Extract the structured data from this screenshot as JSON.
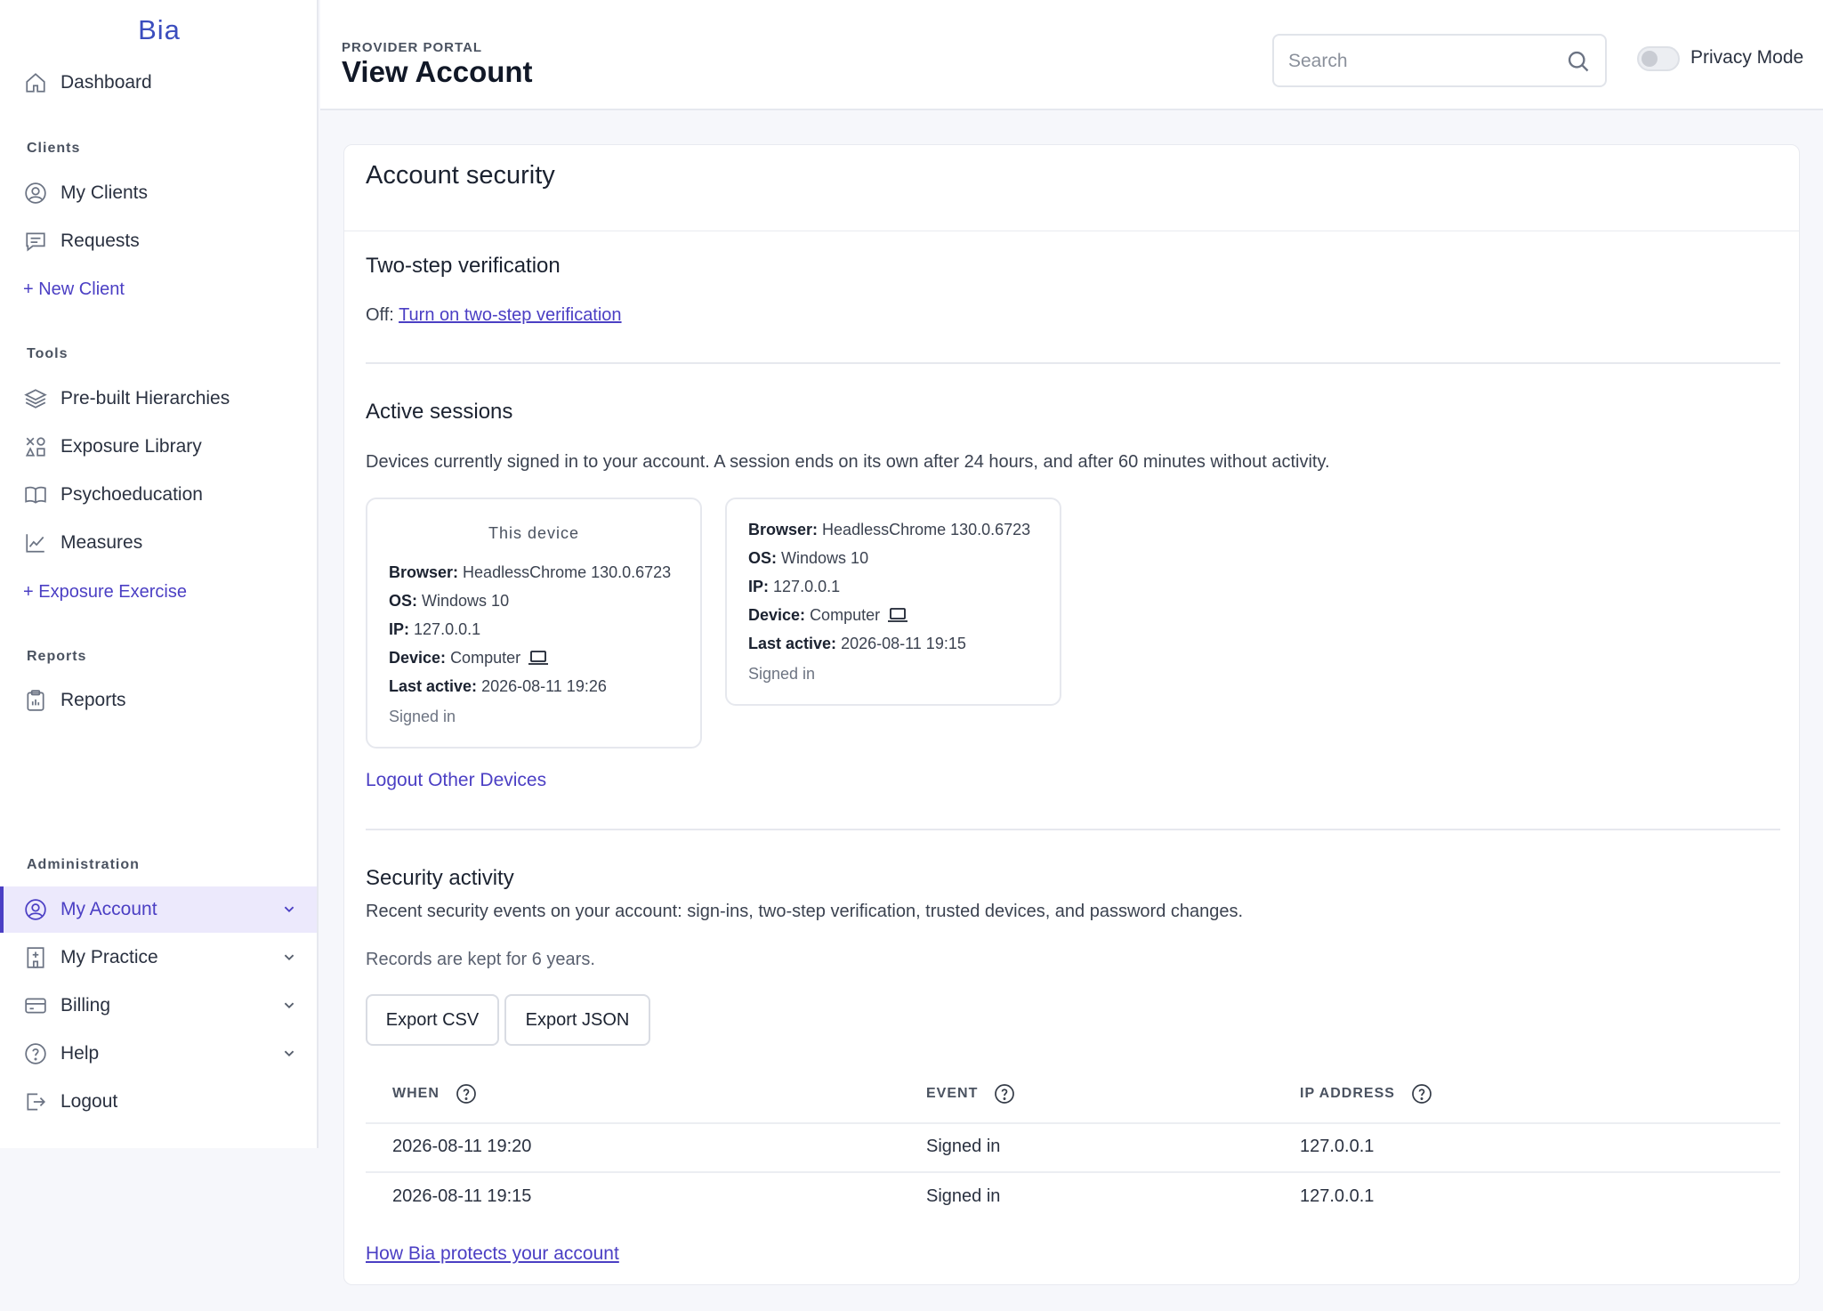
{
  "brand": "Bia",
  "header": {
    "portal_label": "PROVIDER PORTAL",
    "title": "View Account",
    "search_placeholder": "Search",
    "privacy_mode_label": "Privacy Mode",
    "privacy_mode_on": false
  },
  "sidebar": {
    "dashboard": "Dashboard",
    "clients_section": "Clients",
    "my_clients": "My Clients",
    "requests": "Requests",
    "new_client": "+ New Client",
    "tools_section": "Tools",
    "prebuilt": "Pre-built Hierarchies",
    "exposure_library": "Exposure Library",
    "psychoeducation": "Psychoeducation",
    "measures": "Measures",
    "exposure_exercise": "+ Exposure Exercise",
    "reports_section": "Reports",
    "reports": "Reports",
    "admin_section": "Administration",
    "my_account": "My Account",
    "my_practice": "My Practice",
    "billing": "Billing",
    "help": "Help",
    "logout": "Logout",
    "accent_color": "#4b3fc4"
  },
  "account_security": {
    "title": "Account security",
    "two_step": {
      "title": "Two-step verification",
      "status": "Off:",
      "link": "Turn on two-step verification"
    },
    "active_sessions": {
      "title": "Active sessions",
      "description": "Devices currently signed in to your account. A session ends on its own after 24 hours, and after 60 minutes without activity.",
      "sessions": [
        {
          "header": "This device",
          "browser_label": "Browser:",
          "browser": "HeadlessChrome 130.0.6723",
          "os_label": "OS:",
          "os": "Windows 10",
          "ip_label": "IP:",
          "ip": "127.0.0.1",
          "device_label": "Device:",
          "device": "Computer",
          "last_active_label": "Last active:",
          "last_active": "2026-08-11 19:26",
          "status": "Signed in"
        },
        {
          "browser_label": "Browser:",
          "browser": "HeadlessChrome 130.0.6723",
          "os_label": "OS:",
          "os": "Windows 10",
          "ip_label": "IP:",
          "ip": "127.0.0.1",
          "device_label": "Device:",
          "device": "Computer",
          "last_active_label": "Last active:",
          "last_active": "2026-08-11 19:15",
          "status": "Signed in"
        }
      ],
      "logout_other": "Logout Other Devices"
    },
    "security_activity": {
      "title": "Security activity",
      "description": "Recent security events on your account: sign-ins, two-step verification, trusted devices, and password changes.",
      "retention": "Records are kept for 6 years.",
      "export_csv": "Export CSV",
      "export_json": "Export JSON",
      "columns": [
        "WHEN",
        "EVENT",
        "IP ADDRESS"
      ],
      "rows": [
        {
          "when": "2026-08-11 19:20",
          "event": "Signed in",
          "ip": "127.0.0.1"
        },
        {
          "when": "2026-08-11 19:15",
          "event": "Signed in",
          "ip": "127.0.0.1"
        }
      ]
    },
    "footer_link": "How Bia protects your account"
  }
}
